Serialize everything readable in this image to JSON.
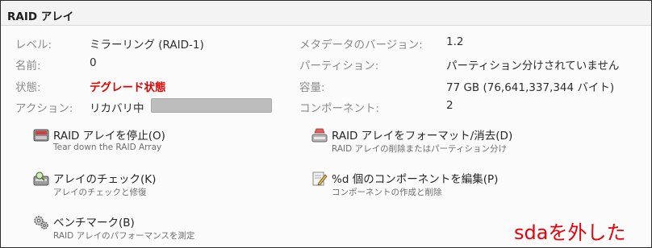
{
  "header": {
    "title": "RAID アレイ"
  },
  "details": {
    "left": [
      {
        "label": "レベル:",
        "value": "ミラーリング (RAID-1)"
      },
      {
        "label": "名前:",
        "value": "0"
      },
      {
        "label": "状態:",
        "value": "デグレード状態"
      },
      {
        "label": "アクション:",
        "value": "リカバリ中"
      }
    ],
    "right": [
      {
        "label": "メタデータのバージョン:",
        "value": "1.2"
      },
      {
        "label": "パーティション:",
        "value": "パーティション分けされていません"
      },
      {
        "label": "容量:",
        "value": "77 GB (76,641,337,344 バイト)"
      },
      {
        "label": "コンポーネント:",
        "value": "2"
      }
    ]
  },
  "actions": {
    "stop": {
      "title": "RAID アレイを停止(O)",
      "desc": "Tear down the RAID Array"
    },
    "format": {
      "title": "RAID アレイをフォーマット/消去(D)",
      "desc": "RAID アレイの削除またはパーティション分け"
    },
    "check": {
      "title": "アレイのチェック(K)",
      "desc": "アレイのチェックと修復"
    },
    "edit": {
      "title": "%d 個のコンポーネントを編集(P)",
      "desc": "コンポーネントの作成と削除"
    },
    "benchmark": {
      "title": "ベンチマーク(B)",
      "desc": "RAID アレイのパフォーマンスを測定"
    }
  },
  "annotation": "sdaを外した",
  "colors": {
    "degraded": "#e00000",
    "annotation": "#e8000b"
  }
}
